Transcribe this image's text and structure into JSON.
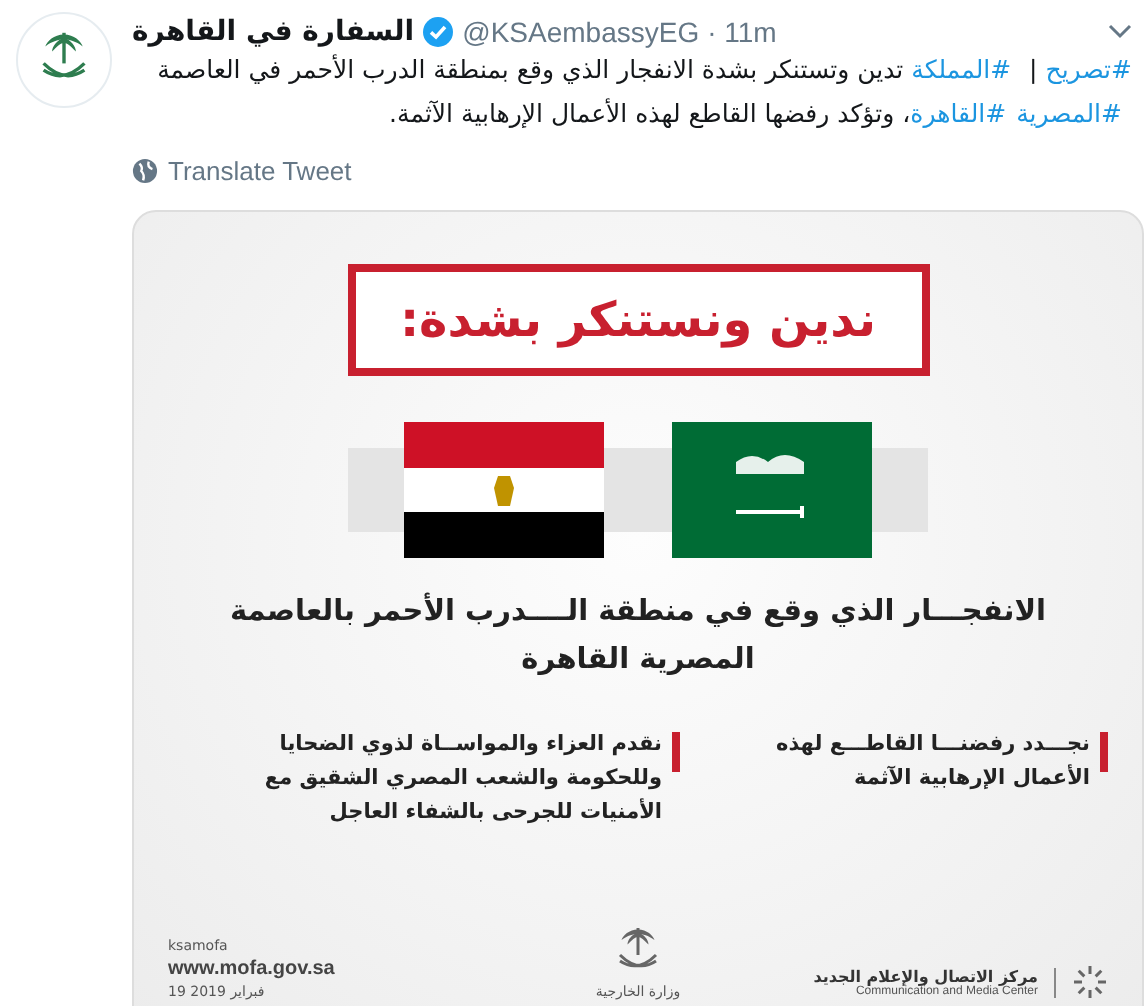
{
  "tweet": {
    "author_name": "السفارة في القاهرة",
    "verified": true,
    "handle": "@KSAembassyEG",
    "time": "· 11m",
    "text_segments": [
      {
        "kind": "hashtag",
        "text": "#تصريح"
      },
      {
        "kind": "plain",
        "text": " | "
      },
      {
        "kind": "hashtag",
        "text": "#المملكة"
      },
      {
        "kind": "plain",
        "text": " تدين وتستنكر بشدة الانفجار الذي وقع بمنطقة الدرب الأحمر في العاصمة "
      },
      {
        "kind": "hashtag",
        "text": "#المصرية"
      },
      {
        "kind": "hashtag",
        "text": "#القاهرة"
      },
      {
        "kind": "plain",
        "text": "، وتؤكد رفضها القاطع لهذه الأعمال الإرهابية الآثمة."
      }
    ],
    "translate_label": "Translate Tweet"
  },
  "graphic": {
    "headline": "ندين ونستنكر بشدة:",
    "flags": [
      {
        "kind": "egypt"
      },
      {
        "kind": "saudi"
      }
    ],
    "subtitle_lines": [
      "الانفجـــار الذي وقع في منطقة الــــدرب الأحمر بالعاصمة",
      "المصرية القاهرة"
    ],
    "columns": [
      {
        "lines": [
          "نجـــدد رفضنـــا القاطـــع لهذه",
          "الأعمال الإرهابية الآثمة"
        ]
      },
      {
        "lines": [
          "نقدم العزاء والمواســاة لذوي الضحايا",
          "وللحكومة والشعب المصري الشقيق مع",
          "الأمنيات للجرحى بالشفاء العاجل"
        ]
      }
    ],
    "footer": {
      "social_handle": "ksamofa",
      "website": "www.mofa.gov.sa",
      "date": "19 فبراير 2019",
      "ministry_name": "وزارة الخارجية",
      "center_name": "مركز الاتصال والإعلام الجديد",
      "center_name_en": "Communication and Media Center"
    }
  }
}
